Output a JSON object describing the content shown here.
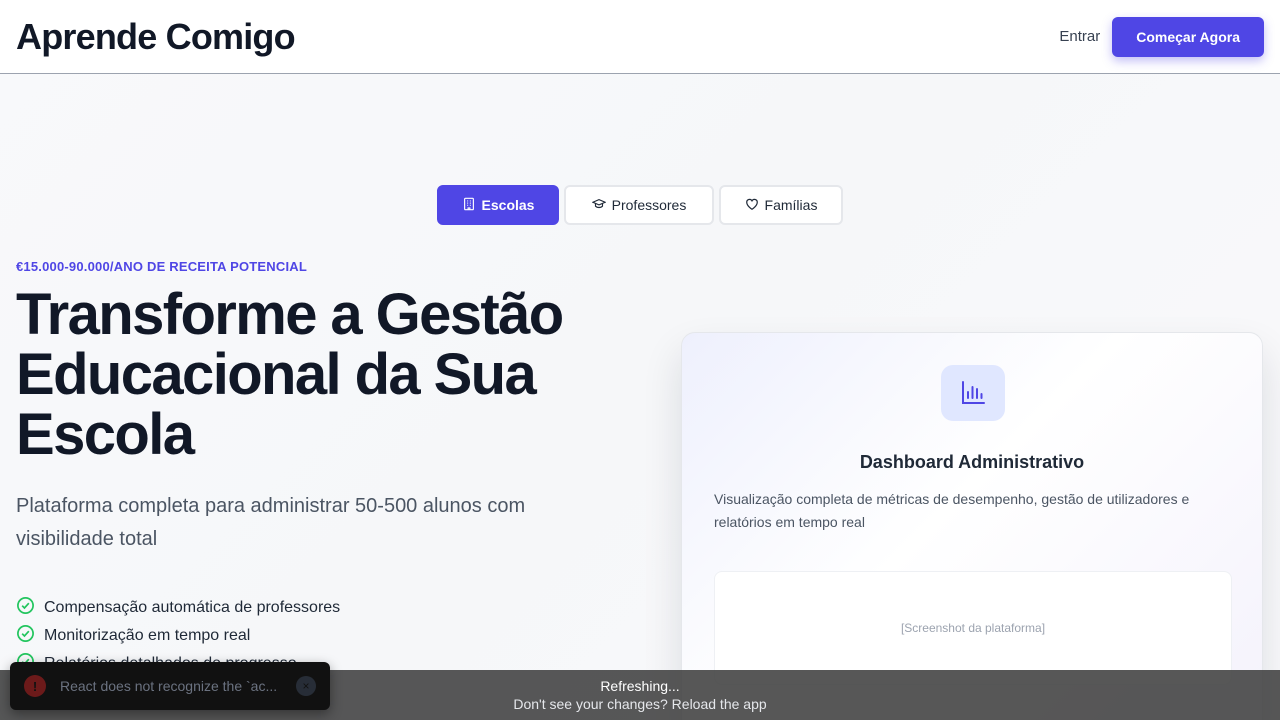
{
  "header": {
    "logo": "Aprende Comigo",
    "login_label": "Entrar",
    "cta_label": "Começar Agora"
  },
  "tabs": [
    {
      "label": "Escolas",
      "icon": "building-icon",
      "active": true
    },
    {
      "label": "Professores",
      "icon": "graduation-cap-icon",
      "active": false
    },
    {
      "label": "Famílias",
      "icon": "heart-icon",
      "active": false
    }
  ],
  "hero": {
    "eyebrow": "€15.000-90.000/ANO DE RECEITA POTENCIAL",
    "title": "Transforme a Gestão Educacional da Sua Escola",
    "subtitle": "Plataforma completa para administrar 50-500 alunos com visibilidade total",
    "features": [
      "Compensação automática de professores",
      "Monitorização em tempo real",
      "Relatórios detalhados de progresso"
    ]
  },
  "card": {
    "icon": "bar-chart-icon",
    "title": "Dashboard Administrativo",
    "description": "Visualização completa de métricas de desempenho, gestão de utilizadores e relatórios em tempo real",
    "placeholder": "[Screenshot da plataforma]"
  },
  "refresh": {
    "title": "Refreshing...",
    "subtitle": "Don't see your changes? Reload the app"
  },
  "toast": {
    "message": "React does not recognize the `ac...",
    "icon": "alert-icon"
  },
  "colors": {
    "accent": "#4f46e5",
    "check": "#22c55e",
    "text": "#111827"
  }
}
